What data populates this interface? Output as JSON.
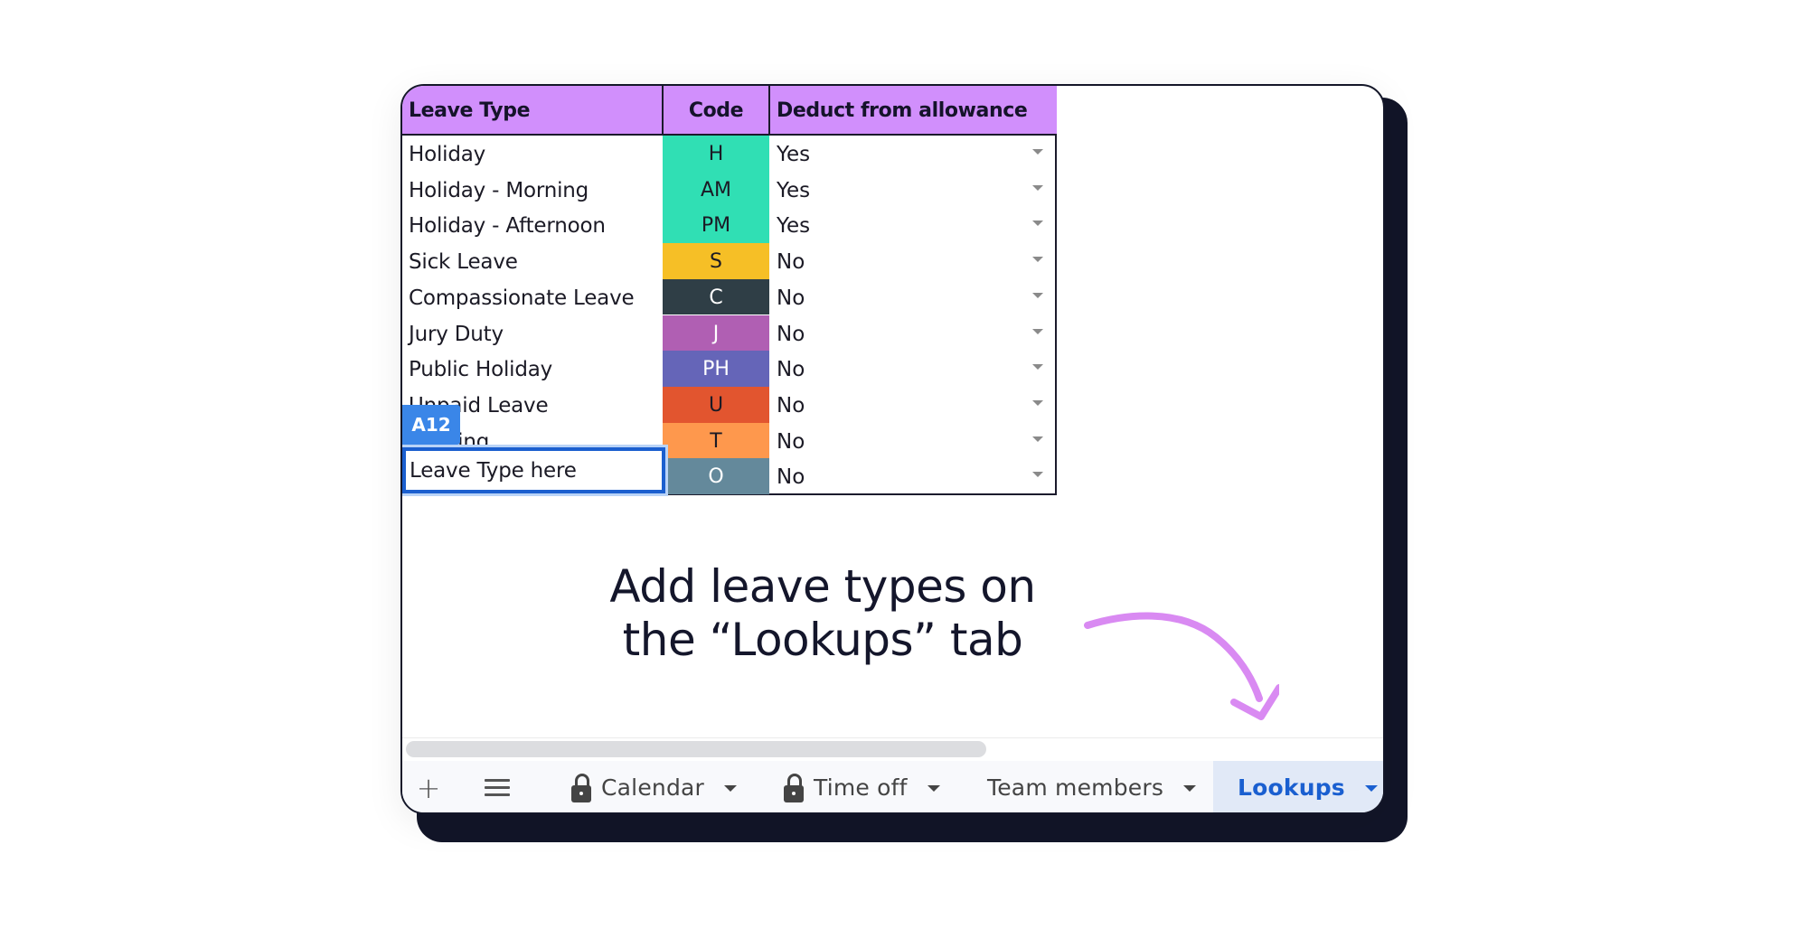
{
  "table": {
    "headers": {
      "leave_type": "Leave Type",
      "code": "Code",
      "deduct": "Deduct from allowance"
    },
    "rows": [
      {
        "leave_type": "Holiday",
        "code": "H",
        "code_color": "#30dfb4",
        "code_text_light": false,
        "deduct": "Yes"
      },
      {
        "leave_type": "Holiday - Morning",
        "code": "AM",
        "code_color": "#30dfb4",
        "code_text_light": false,
        "deduct": "Yes"
      },
      {
        "leave_type": "Holiday - Afternoon",
        "code": "PM",
        "code_color": "#30dfb4",
        "code_text_light": false,
        "deduct": "Yes"
      },
      {
        "leave_type": "Sick Leave",
        "code": "S",
        "code_color": "#f6bf26",
        "code_text_light": false,
        "deduct": "No"
      },
      {
        "leave_type": "Compassionate Leave",
        "code": "C",
        "code_color": "#2f3e46",
        "code_text_light": true,
        "deduct": "No"
      },
      {
        "leave_type": "Jury Duty",
        "code": "J",
        "code_color": "#b05fb3",
        "code_text_light": true,
        "deduct": "No"
      },
      {
        "leave_type": "Public Holiday",
        "code": "PH",
        "code_color": "#6565b8",
        "code_text_light": true,
        "deduct": "No"
      },
      {
        "leave_type": "Unpaid Leave",
        "code": "U",
        "code_color": "#e2552f",
        "code_text_light": false,
        "deduct": "No"
      },
      {
        "leave_type": "Training",
        "code": "T",
        "code_color": "#fe984d",
        "code_text_light": false,
        "deduct": "No"
      },
      {
        "leave_type": "",
        "code": "O",
        "code_color": "#64899b",
        "code_text_light": true,
        "deduct": "No"
      }
    ],
    "header_color": "#d18ffc"
  },
  "selection": {
    "cell_ref": "A12",
    "input_value": "Leave Type here"
  },
  "annotation": {
    "line1": "Add leave types on",
    "line2": "the “Lookups” tab",
    "arrow_color": "#d98af2"
  },
  "tabbar": {
    "add_icon": "plus-icon",
    "menu_icon": "menu-icon",
    "tabs": [
      {
        "label": "Calendar",
        "locked": true,
        "active": false
      },
      {
        "label": "Time off",
        "locked": true,
        "active": false
      },
      {
        "label": "Team members",
        "locked": false,
        "active": false
      },
      {
        "label": "Lookups",
        "locked": false,
        "active": true
      }
    ]
  }
}
